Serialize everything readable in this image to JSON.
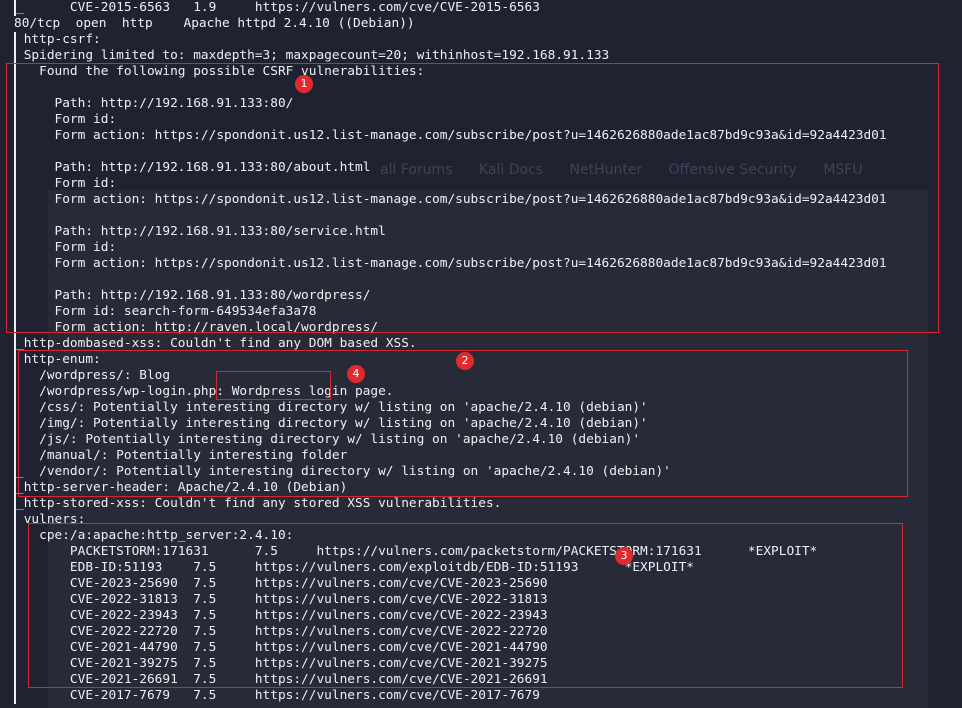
{
  "terminal": {
    "lines": [
      "|_      CVE-2015-6563   1.9     https://vulners.com/cve/CVE-2015-6563",
      "80/tcp  open  http    Apache httpd 2.4.10 ((Debian))",
      "| http-csrf:",
      "| Spidering limited to: maxdepth=3; maxpagecount=20; withinhost=192.168.91.133",
      "|   Found the following possible CSRF vulnerabilities:",
      "|",
      "|     Path: http://192.168.91.133:80/",
      "|     Form id:",
      "|     Form action: https://spondonit.us12.list-manage.com/subscribe/post?u=1462626880ade1ac87bd9c93a&id=92a4423d01",
      "|",
      "|     Path: http://192.168.91.133:80/about.html",
      "|     Form id:",
      "|     Form action: https://spondonit.us12.list-manage.com/subscribe/post?u=1462626880ade1ac87bd9c93a&id=92a4423d01",
      "|",
      "|     Path: http://192.168.91.133:80/service.html",
      "|     Form id:",
      "|     Form action: https://spondonit.us12.list-manage.com/subscribe/post?u=1462626880ade1ac87bd9c93a&id=92a4423d01",
      "|",
      "|     Path: http://192.168.91.133:80/wordpress/",
      "|     Form id: search-form-649534efa3a78",
      "|     Form action: http://raven.local/wordpress/",
      "|_http-dombased-xss: Couldn't find any DOM based XSS.",
      "| http-enum:",
      "|   /wordpress/: Blog",
      "|   /wordpress/wp-login.php: Wordpress login page.",
      "|   /css/: Potentially interesting directory w/ listing on 'apache/2.4.10 (debian)'",
      "|   /img/: Potentially interesting directory w/ listing on 'apache/2.4.10 (debian)'",
      "|   /js/: Potentially interesting directory w/ listing on 'apache/2.4.10 (debian)'",
      "|   /manual/: Potentially interesting folder",
      "|_  /vendor/: Potentially interesting directory w/ listing on 'apache/2.4.10 (debian)'",
      "|_http-server-header: Apache/2.4.10 (Debian)",
      "|_http-stored-xss: Couldn't find any stored XSS vulnerabilities.",
      "| vulners:",
      "|   cpe:/a:apache:http_server:2.4.10:",
      "|       PACKETSTORM:171631      7.5     https://vulners.com/packetstorm/PACKETSTORM:171631      *EXPLOIT*",
      "|       EDB-ID:51193    7.5     https://vulners.com/exploitdb/EDB-ID:51193      *EXPLOIT*",
      "|       CVE-2023-25690  7.5     https://vulners.com/cve/CVE-2023-25690",
      "|       CVE-2022-31813  7.5     https://vulners.com/cve/CVE-2022-31813",
      "|       CVE-2022-23943  7.5     https://vulners.com/cve/CVE-2022-23943",
      "|       CVE-2022-22720  7.5     https://vulners.com/cve/CVE-2022-22720",
      "|       CVE-2021-44790  7.5     https://vulners.com/cve/CVE-2021-44790",
      "|       CVE-2021-39275  7.5     https://vulners.com/cve/CVE-2021-39275",
      "|       CVE-2021-26691  7.5     https://vulners.com/cve/CVE-2021-26691",
      "|       CVE-2017-7679   7.5     https://vulners.com/cve/CVE-2017-7679"
    ]
  },
  "background_tabs": [
    "all Forums",
    "Kali Docs",
    "NetHunter",
    "Offensive Security",
    "MSFU"
  ],
  "annotations": [
    "1",
    "2",
    "3",
    "4"
  ],
  "colors": {
    "background": "#1f2230",
    "text": "#eef0f5",
    "annotation": "#d7262f"
  }
}
